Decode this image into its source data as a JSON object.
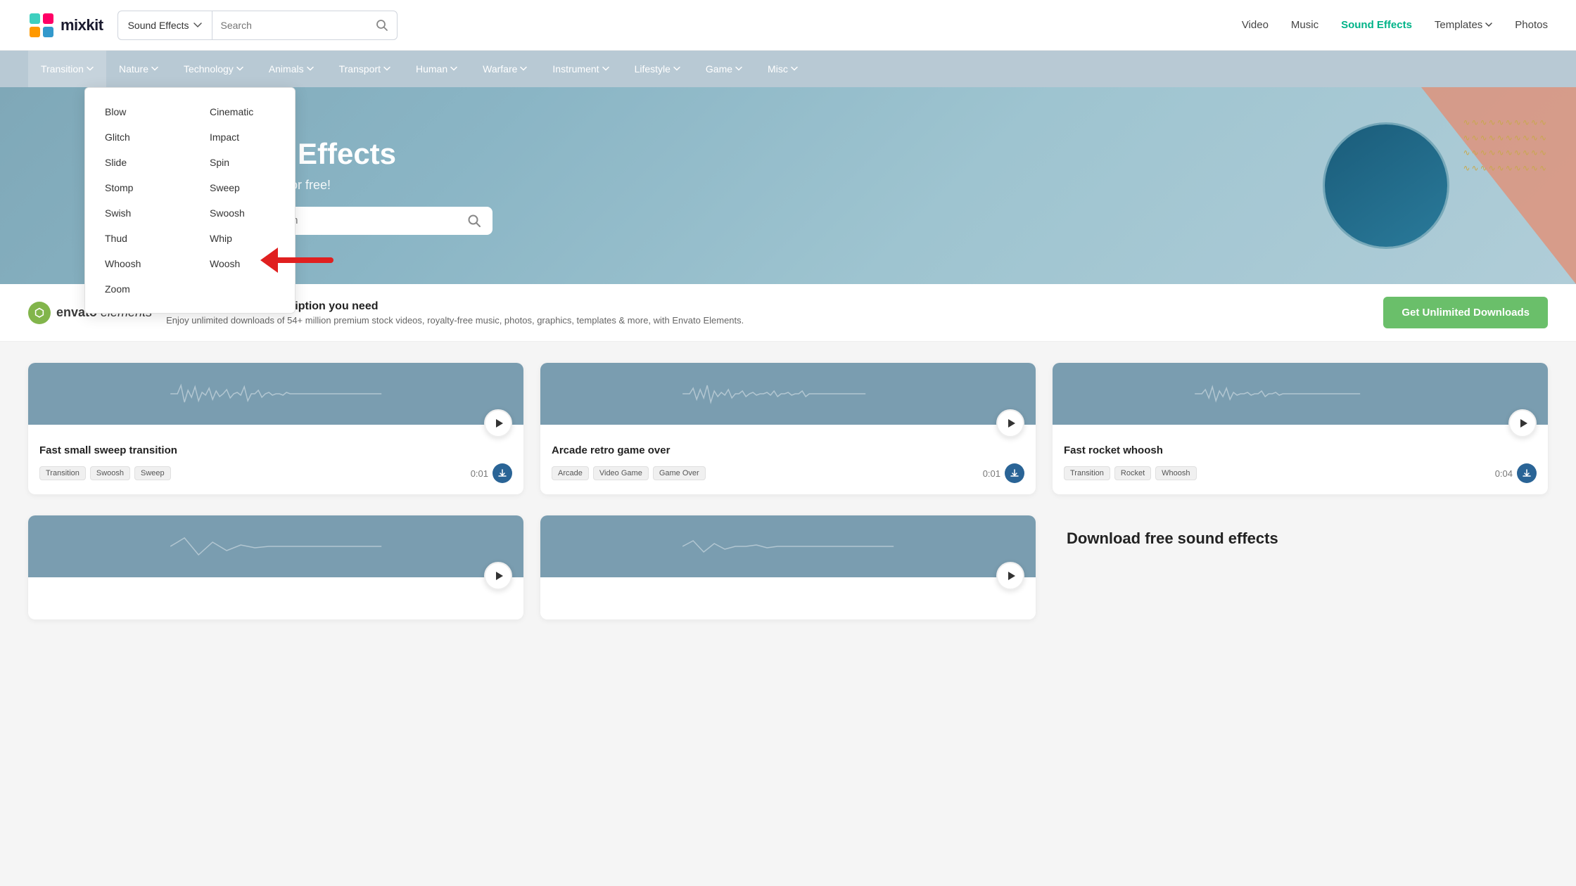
{
  "header": {
    "logo_text": "mixkit",
    "dropdown_label": "Sound Effects",
    "search_placeholder": "Search",
    "nav_items": [
      {
        "label": "Video",
        "active": false
      },
      {
        "label": "Music",
        "active": false
      },
      {
        "label": "Sound Effects",
        "active": true
      },
      {
        "label": "Templates",
        "active": false,
        "has_arrow": true
      },
      {
        "label": "Photos",
        "active": false
      }
    ]
  },
  "category_nav": {
    "items": [
      {
        "label": "Transition",
        "has_arrow": true,
        "active": true
      },
      {
        "label": "Nature",
        "has_arrow": true
      },
      {
        "label": "Technology",
        "has_arrow": true
      },
      {
        "label": "Animals",
        "has_arrow": true
      },
      {
        "label": "Transport",
        "has_arrow": true
      },
      {
        "label": "Human",
        "has_arrow": true
      },
      {
        "label": "Warfare",
        "has_arrow": true
      },
      {
        "label": "Instrument",
        "has_arrow": true
      },
      {
        "label": "Lifestyle",
        "has_arrow": true
      },
      {
        "label": "Game",
        "has_arrow": true
      },
      {
        "label": "Misc",
        "has_arrow": true
      }
    ]
  },
  "dropdown_menu": {
    "items_col1": [
      "Blow",
      "Glitch",
      "Slide",
      "Stomp",
      "Swish",
      "Thud",
      "Whoosh",
      "Zoom"
    ],
    "items_col2": [
      "Cinematic",
      "Impact",
      "Spin",
      "Sweep",
      "Swoosh",
      "Whip",
      "Woosh"
    ]
  },
  "hero": {
    "title": "nd Effects",
    "subtitle": "oject, for free!",
    "search_placeholder": "Search"
  },
  "banner": {
    "logo_text": "envato",
    "logo_sub": "elements",
    "headline": "the only creative subscription you need",
    "sub_text": "Enjoy unlimited downloads of 54+ million premium stock videos, royalty-free music, photos, graphics, templates & more, with Envato Elements.",
    "cta_label": "Get Unlimited Downloads"
  },
  "sound_cards": [
    {
      "title": "Fast small sweep transition",
      "tags": [
        "Transition",
        "Swoosh",
        "Sweep"
      ],
      "duration": "0:01"
    },
    {
      "title": "Arcade retro game over",
      "tags": [
        "Arcade",
        "Video Game",
        "Game Over"
      ],
      "duration": "0:01"
    },
    {
      "title": "Fast rocket whoosh",
      "tags": [
        "Transition",
        "Rocket",
        "Whoosh"
      ],
      "duration": "0:04"
    }
  ],
  "sound_cards_row2": [
    {
      "title": "",
      "tags": [],
      "duration": ""
    },
    {
      "title": "",
      "tags": [],
      "duration": ""
    }
  ],
  "bottom": {
    "download_title": "Download free sound effects"
  }
}
